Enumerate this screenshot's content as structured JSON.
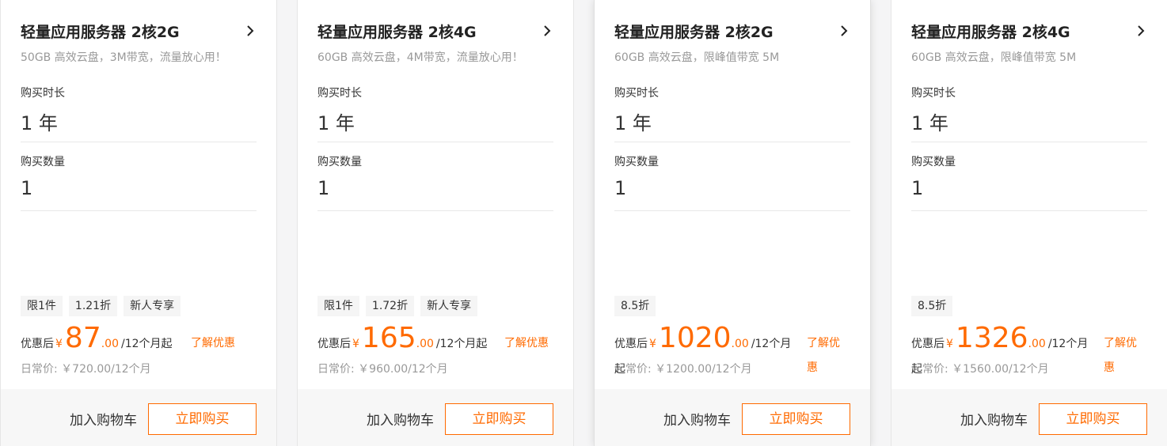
{
  "cards": [
    {
      "title": "轻量应用服务器 2核2G",
      "subtitle": "50GB 高效云盘，3M带宽，流量放心用！",
      "duration_label": "购买时长",
      "duration_value": "1 年",
      "qty_label": "购买数量",
      "qty_value": "1",
      "tags": [
        "限1件",
        "1.21折",
        "新人专享"
      ],
      "price_label": "优惠后",
      "currency": "¥",
      "price_int": "87",
      "price_cents": ".00",
      "price_unit": "/12个月起",
      "learn_more": "了解优惠",
      "orig_prefix": "",
      "orig_text": "日常价: ￥720.00/12个月",
      "cart_label": "加入购物车",
      "buy_label": "立即购买"
    },
    {
      "title": "轻量应用服务器 2核4G",
      "subtitle": "60GB 高效云盘，4M带宽，流量放心用！",
      "duration_label": "购买时长",
      "duration_value": "1 年",
      "qty_label": "购买数量",
      "qty_value": "1",
      "tags": [
        "限1件",
        "1.72折",
        "新人专享"
      ],
      "price_label": "优惠后",
      "currency": "¥",
      "price_int": "165",
      "price_cents": ".00",
      "price_unit": "/12个月起",
      "learn_more": "了解优惠",
      "orig_prefix": "",
      "orig_text": "日常价: ￥960.00/12个月",
      "cart_label": "加入购物车",
      "buy_label": "立即购买"
    },
    {
      "title": "轻量应用服务器 2核2G",
      "subtitle": "60GB 高效云盘，限峰值带宽 5M",
      "duration_label": "购买时长",
      "duration_value": "1 年",
      "qty_label": "购买数量",
      "qty_value": "1",
      "tags": [
        "8.5折"
      ],
      "price_label": "优惠后",
      "currency": "¥",
      "price_int": "1020",
      "price_cents": ".00",
      "price_unit": "/12个月",
      "learn_more": "了解优惠",
      "orig_prefix": "起",
      "orig_text": "常价: ￥1200.00/12个月",
      "cart_label": "加入购物车",
      "buy_label": "立即购买"
    },
    {
      "title": "轻量应用服务器 2核4G",
      "subtitle": "60GB 高效云盘，限峰值带宽 5M",
      "duration_label": "购买时长",
      "duration_value": "1 年",
      "qty_label": "购买数量",
      "qty_value": "1",
      "tags": [
        "8.5折"
      ],
      "price_label": "优惠后",
      "currency": "¥",
      "price_int": "1326",
      "price_cents": ".00",
      "price_unit": "/12个月",
      "learn_more": "了解优惠",
      "orig_prefix": "起",
      "orig_text": "常价: ￥1560.00/12个月",
      "cart_label": "加入购物车",
      "buy_label": "立即购买"
    }
  ],
  "icons": {
    "chevron": "chevron-right-icon"
  },
  "colors": {
    "accent": "#ff6a00",
    "muted": "#999999",
    "text": "#333333"
  }
}
